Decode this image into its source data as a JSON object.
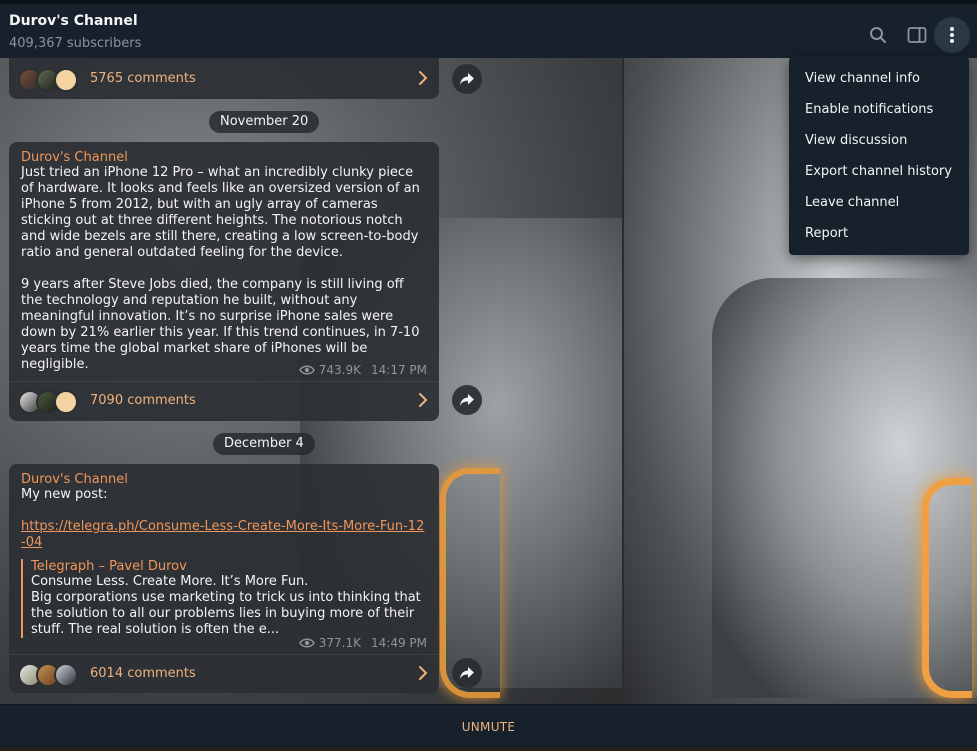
{
  "header": {
    "title": "Durov's Channel",
    "subtitle": "409,367 subscribers"
  },
  "menu": {
    "items": [
      {
        "label": "View channel info"
      },
      {
        "label": "Enable notifications"
      },
      {
        "label": "View discussion"
      },
      {
        "label": "Export channel history"
      },
      {
        "label": "Leave channel"
      },
      {
        "label": "Report"
      }
    ]
  },
  "posts": [
    {
      "comments": "5765 comments"
    },
    {
      "date": "November 20",
      "sender": "Durov's Channel",
      "text": "Just tried an iPhone 12 Pro – what an incredibly clunky piece of hardware. It looks and feels like an oversized version of an iPhone 5 from 2012, but with an ugly array of cameras sticking out at three different heights. The notorious notch and wide bezels are still there, creating a low screen-to-body ratio and general outdated feeling for the device.\n\n9 years after Steve Jobs died, the company is still living off the technology and reputation he built, without any meaningful innovation. It’s no surprise iPhone sales were down by 21% earlier this year. If this trend continues, in 7-10 years time the global market share of iPhones will be negligible.",
      "views": "743.9K",
      "time": "14:17 PM",
      "comments": "7090 comments"
    },
    {
      "date": "December 4",
      "sender": "Durov's Channel",
      "text": "My new post:",
      "link": "https://telegra.ph/Consume-Less-Create-More-Its-More-Fun-12-04",
      "preview_title": "Telegraph – Pavel Durov",
      "preview_heading": "Consume Less. Create More. It’s More Fun.",
      "preview_body": "Big corporations use marketing to trick us into thinking that the solution to all our problems lies in buying more of their stuff. The real solution is often the e...",
      "views": "377.1K",
      "time": "14:49 PM",
      "comments": "6014 comments"
    }
  ],
  "bottom": {
    "unmute": "UNMUTE"
  },
  "colors": {
    "accent": "#f0965a",
    "header_bg": "#17212b",
    "bubble_bg": "#2b2f33"
  }
}
